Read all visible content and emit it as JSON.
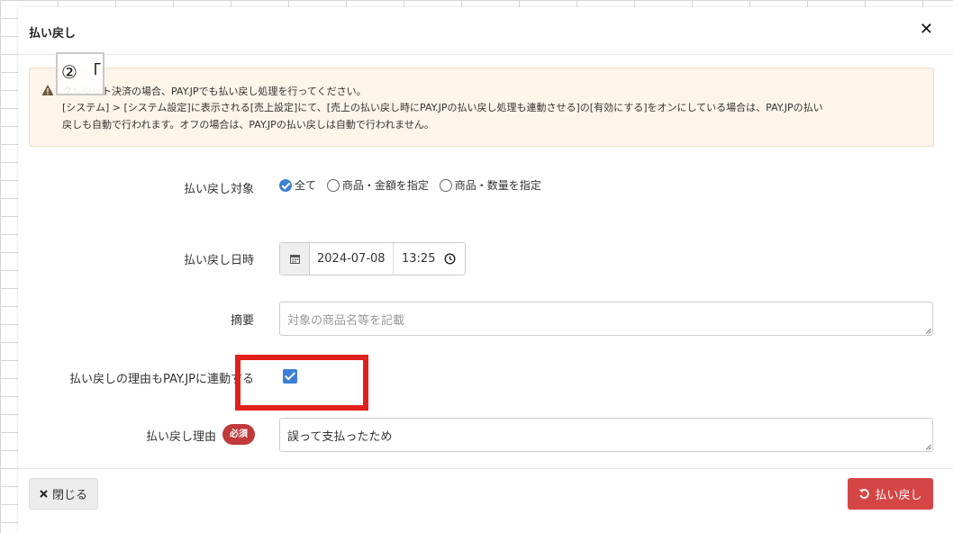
{
  "modal": {
    "title": "払い戻し",
    "close_icon": "✕"
  },
  "annotation": {
    "text": "② 「"
  },
  "alert": {
    "icon": "warning-icon",
    "line1": "クレジット決済の場合、PAY.JPでも払い戻し処理を行ってください。",
    "line2": "[システム] > [システム設定]に表示される[売上設定]にて、[売上の払い戻し時にPAY.JPの払い戻し処理も連動させる]の[有効にする]をオンにしている場合は、PAY.JPの払い",
    "line3": "戻しも自動で行われます。オフの場合は、PAY.JPの払い戻しは自動で行われません。"
  },
  "form": {
    "target": {
      "label": "払い戻し対象",
      "options": [
        "全て",
        "商品・金額を指定",
        "商品・数量を指定"
      ],
      "selected": "全て"
    },
    "datetime": {
      "label": "払い戻し日時",
      "date": "2024-07-08",
      "time": "13:25"
    },
    "summary": {
      "label": "摘要",
      "placeholder": "対象の商品名等を記載",
      "value": ""
    },
    "sync": {
      "label": "払い戻しの理由もPAY.JPに連動する",
      "checked": true
    },
    "reason": {
      "label": "払い戻し理由",
      "required_badge": "必須",
      "value": "誤って支払ったため"
    }
  },
  "footer": {
    "close_label": "閉じる",
    "refund_label": "払い戻し"
  },
  "colors": {
    "accent_blue": "#3d7fd6",
    "danger_red": "#d64545",
    "badge_red": "#c0393b",
    "highlight_frame": "#e0201c",
    "alert_bg": "#fdf4ea"
  }
}
